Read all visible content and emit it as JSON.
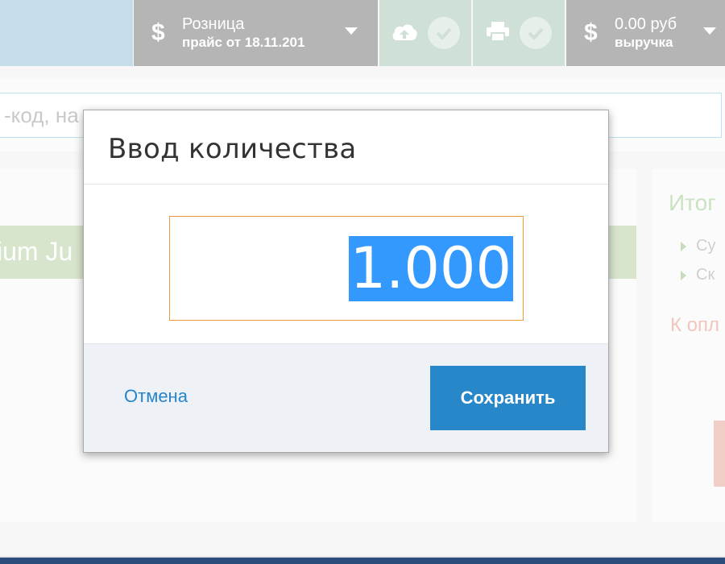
{
  "topbar": {
    "price": {
      "currency_symbol": "$",
      "title": "Розница",
      "subtitle": "прайс от 18.11.201"
    },
    "sync": {
      "icon": "cloud-upload-icon",
      "status_icon": "check-icon"
    },
    "print": {
      "icon": "printer-icon",
      "status_icon": "check-icon"
    },
    "revenue": {
      "currency_symbol": "$",
      "amount": "0.00 руб",
      "label": "выручка"
    }
  },
  "search": {
    "text": "-код, на"
  },
  "main": {
    "row_text": "ium Ju"
  },
  "summary": {
    "title": "Итог",
    "items": [
      "Су",
      "Ск"
    ],
    "to_pay": "К опл"
  },
  "dialog": {
    "title": "Ввод количества",
    "quantity": "1.000",
    "cancel_label": "Отмена",
    "save_label": "Сохранить"
  },
  "colors": {
    "accent": "#2787c8",
    "input_focus": "#ef9a38",
    "selection": "#3399ff",
    "topbar_gray": "#b5b5b5",
    "topbar_green": "#cfe0d6"
  }
}
